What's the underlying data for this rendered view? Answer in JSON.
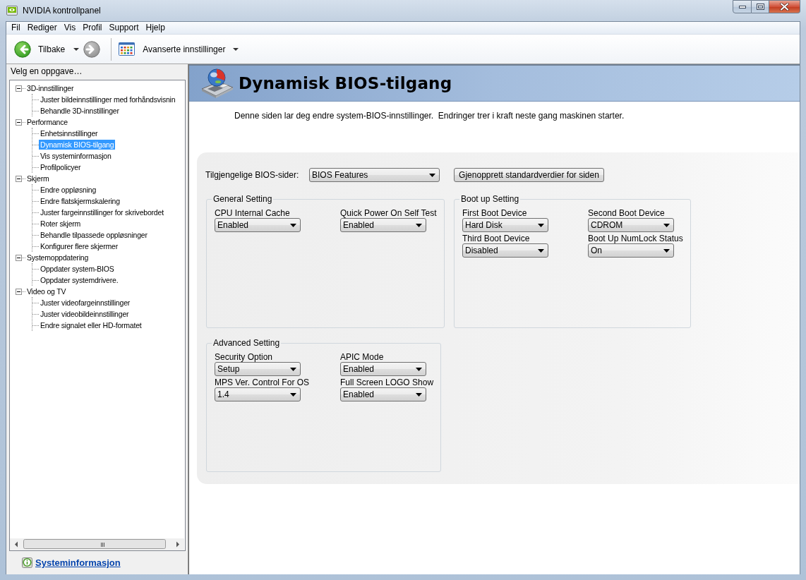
{
  "window": {
    "title": "NVIDIA kontrollpanel"
  },
  "menu": [
    "Fil",
    "Rediger",
    "Vis",
    "Profil",
    "Support",
    "Hjelp"
  ],
  "toolbar": {
    "back": {
      "label": "Tilbake",
      "disabled": false
    },
    "forward": {
      "disabled": true
    },
    "view": {
      "label": "Avanserte innstillinger"
    }
  },
  "sidebar": {
    "heading": "Velg en oppgave…",
    "tree": [
      {
        "label": "3D-innstillinger",
        "selected": false,
        "expanded": true,
        "children": [
          {
            "label": "Juster bildeinnstillinger med forhåndsvisnin",
            "selected": false
          },
          {
            "label": "Behandle 3D-innstillinger",
            "selected": false
          }
        ]
      },
      {
        "label": "Performance",
        "selected": false,
        "expanded": true,
        "children": [
          {
            "label": "Enhetsinnstillinger",
            "selected": false
          },
          {
            "label": "Dynamisk BIOS-tilgang",
            "selected": true
          },
          {
            "label": "Vis systeminformasjon",
            "selected": false
          },
          {
            "label": "Profilpolicyer",
            "selected": false
          }
        ]
      },
      {
        "label": "Skjerm",
        "selected": false,
        "expanded": true,
        "children": [
          {
            "label": "Endre oppløsning",
            "selected": false
          },
          {
            "label": "Endre flatskjermskalering",
            "selected": false
          },
          {
            "label": "Juster fargeinnstillinger for skrivebordet",
            "selected": false
          },
          {
            "label": "Roter skjerm",
            "selected": false
          },
          {
            "label": "Behandle tilpassede oppløsninger",
            "selected": false
          },
          {
            "label": "Konfigurer flere skjermer",
            "selected": false
          }
        ]
      },
      {
        "label": "Systemoppdatering",
        "selected": false,
        "expanded": true,
        "children": [
          {
            "label": "Oppdater system-BIOS",
            "selected": false
          },
          {
            "label": "Oppdater systemdrivere.",
            "selected": false
          }
        ]
      },
      {
        "label": "Video og TV",
        "selected": false,
        "expanded": true,
        "children": [
          {
            "label": "Juster videofargeinnstillinger",
            "selected": false
          },
          {
            "label": "Juster videobildeinnstillinger",
            "selected": false
          },
          {
            "label": "Endre signalet eller HD-formatet",
            "selected": false
          }
        ]
      }
    ],
    "link": "Systeminformasjon"
  },
  "page": {
    "title": "Dynamisk BIOS-tilgang",
    "description": "Denne siden lar deg endre system-BIOS-innstillinger.  Endringer trer i kraft neste gang maskinen starter.",
    "bios_pages": {
      "label": "Tilgjengelige BIOS-sider:",
      "value": "BIOS Features"
    },
    "restore_button": "Gjenopprett standardverdier for siden",
    "groups": [
      {
        "title": "General Setting",
        "fields": [
          {
            "label": "CPU Internal Cache",
            "value": "Enabled"
          },
          {
            "label": "Quick Power On Self Test",
            "value": "Enabled"
          }
        ]
      },
      {
        "title": "Boot up Setting",
        "fields": [
          {
            "label": "First Boot Device",
            "value": "Hard Disk"
          },
          {
            "label": "Second Boot Device",
            "value": "CDROM"
          },
          {
            "label": "Third Boot Device",
            "value": "Disabled"
          },
          {
            "label": "Boot Up NumLock Status",
            "value": "On"
          }
        ]
      },
      {
        "title": "Advanced Setting",
        "fields": [
          {
            "label": "Security Option",
            "value": "Setup"
          },
          {
            "label": "APIC Mode",
            "value": "Enabled"
          },
          {
            "label": "MPS Ver. Control For OS",
            "value": "1.4"
          },
          {
            "label": "Full Screen LOGO Show",
            "value": "Enabled"
          }
        ]
      }
    ]
  }
}
